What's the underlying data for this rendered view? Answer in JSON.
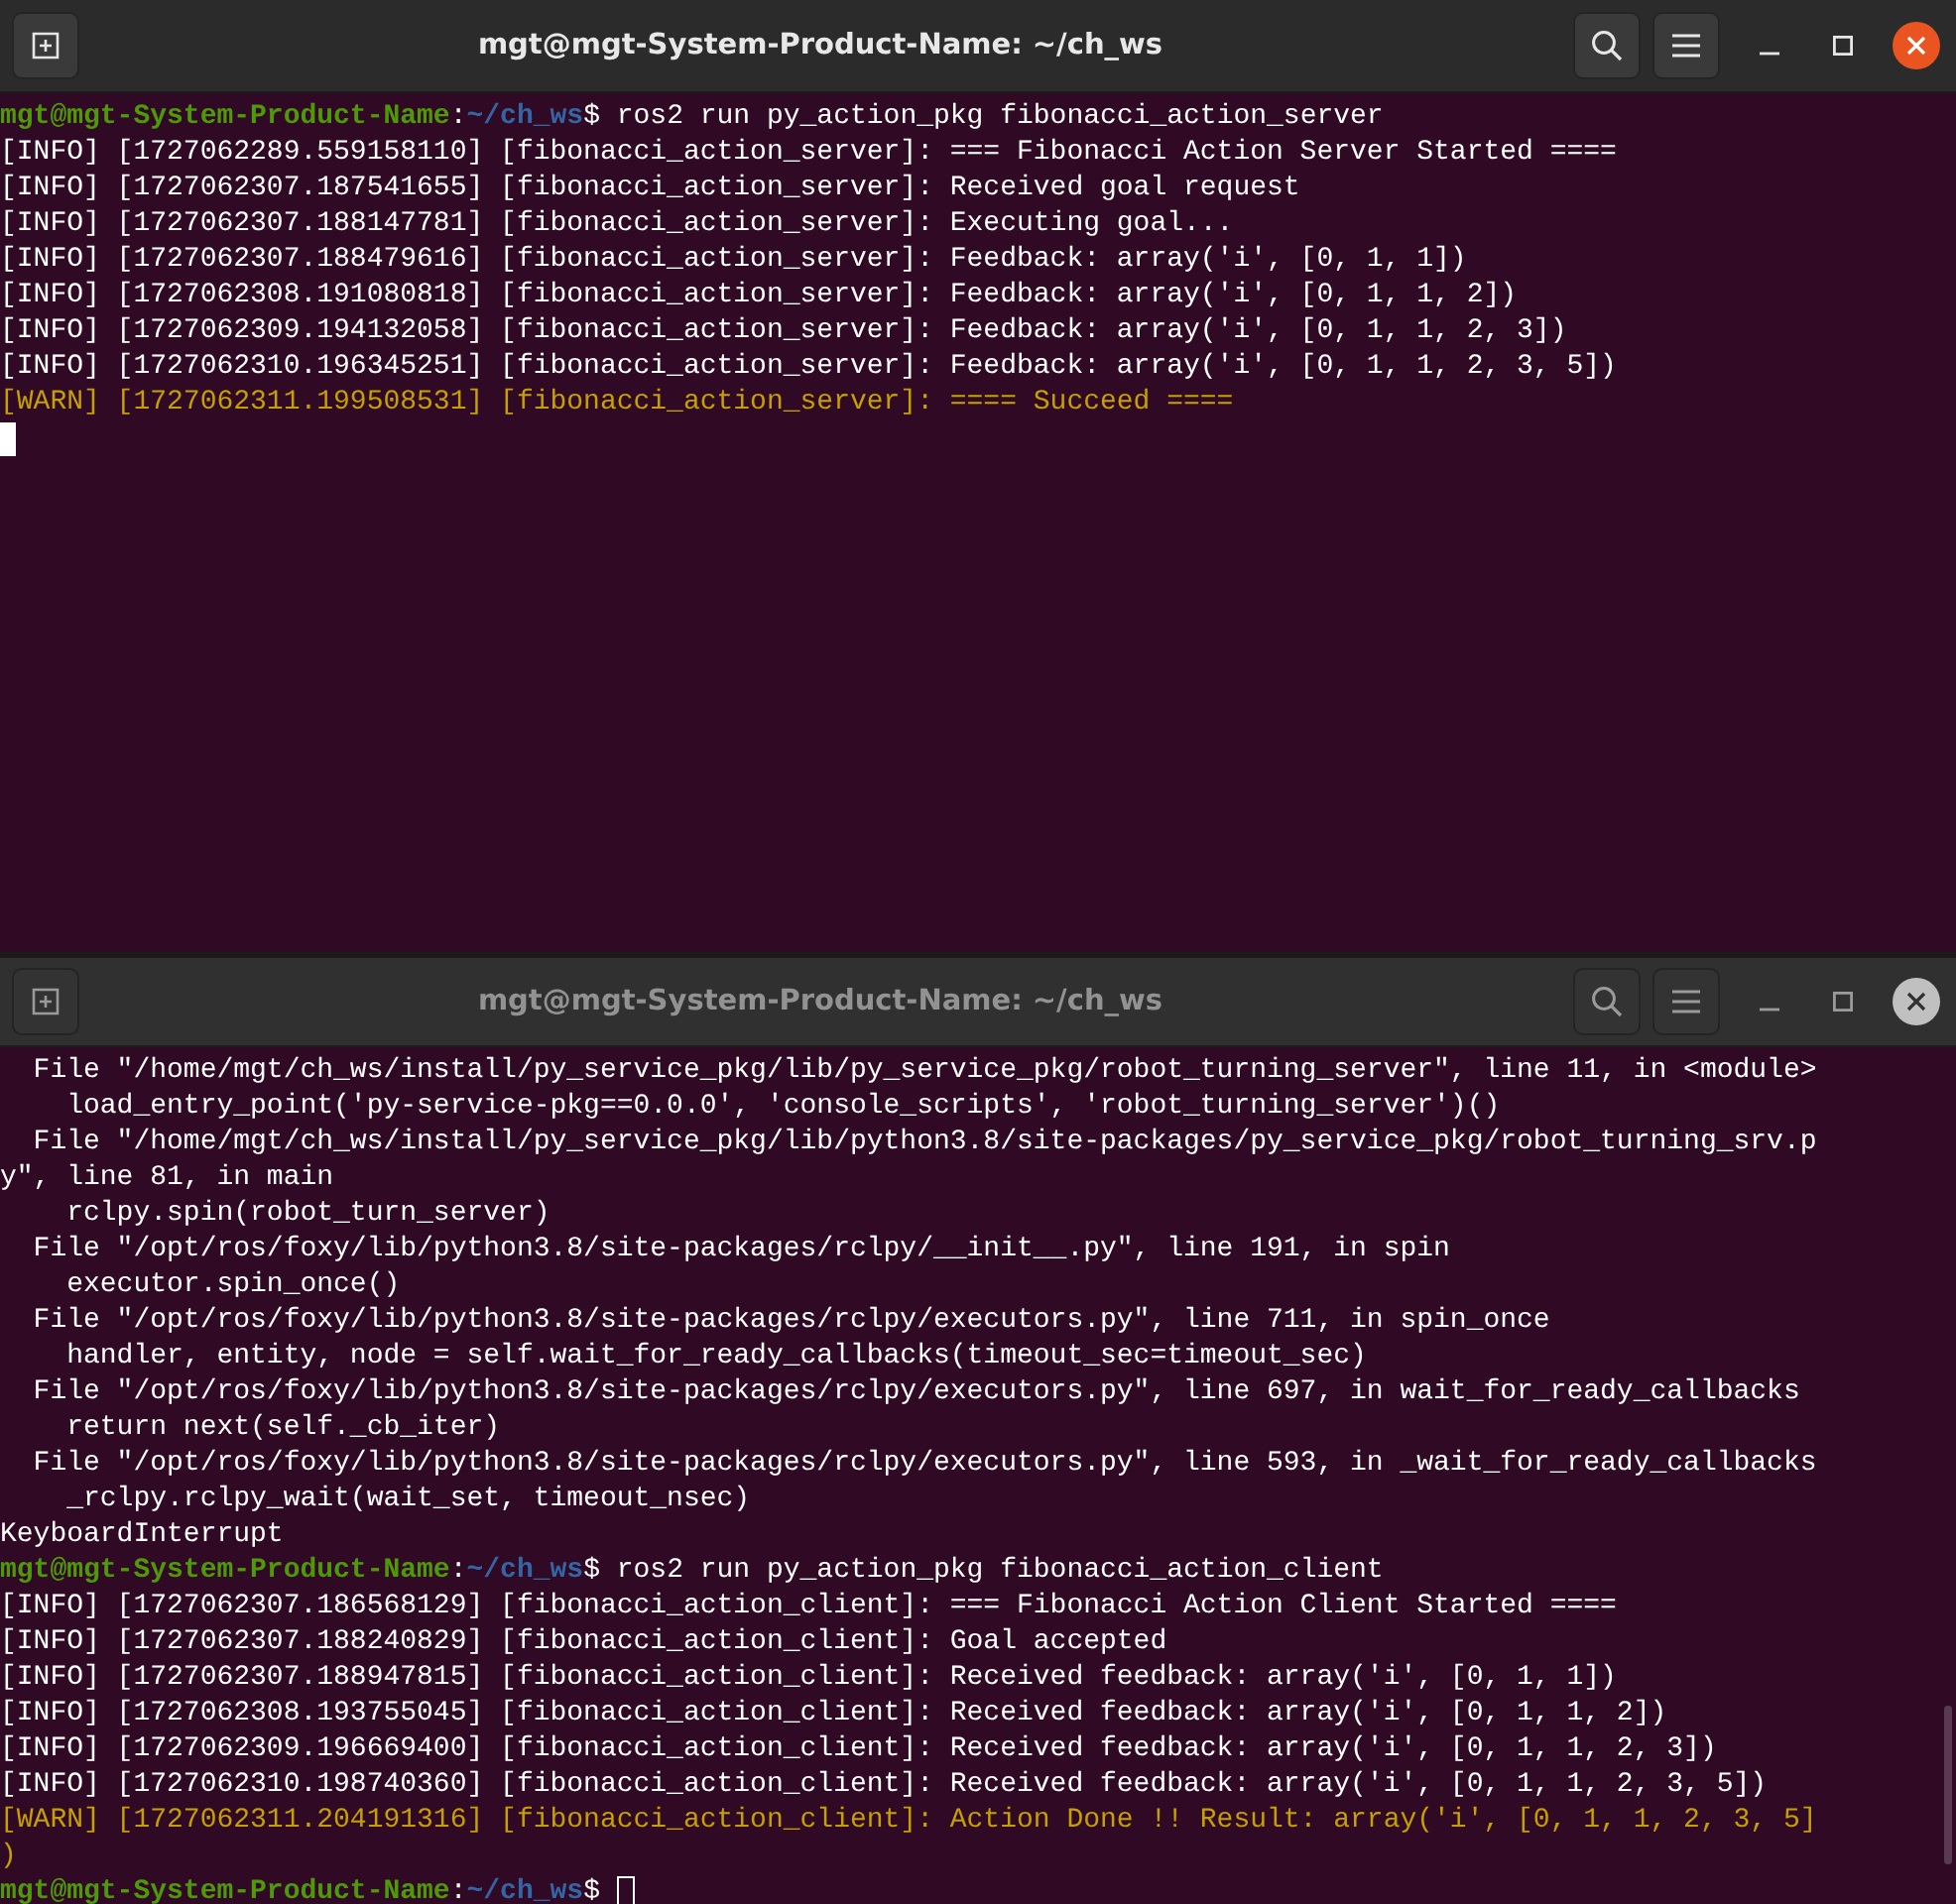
{
  "windows": [
    {
      "title": "mgt@mgt-System-Product-Name: ~/ch_ws",
      "active": true,
      "lines": [
        {
          "kind": "prompt",
          "segments": [
            "mgt@mgt-System-Product-Name",
            ":",
            "~/ch_ws",
            "$ ros2 run py_action_pkg fibonacci_action_server"
          ]
        },
        {
          "kind": "info",
          "text": "[INFO] [1727062289.559158110] [fibonacci_action_server]: === Fibonacci Action Server Started ===="
        },
        {
          "kind": "info",
          "text": "[INFO] [1727062307.187541655] [fibonacci_action_server]: Received goal request"
        },
        {
          "kind": "info",
          "text": "[INFO] [1727062307.188147781] [fibonacci_action_server]: Executing goal..."
        },
        {
          "kind": "info",
          "text": "[INFO] [1727062307.188479616] [fibonacci_action_server]: Feedback: array('i', [0, 1, 1])"
        },
        {
          "kind": "info",
          "text": "[INFO] [1727062308.191080818] [fibonacci_action_server]: Feedback: array('i', [0, 1, 1, 2])"
        },
        {
          "kind": "info",
          "text": "[INFO] [1727062309.194132058] [fibonacci_action_server]: Feedback: array('i', [0, 1, 1, 2, 3])"
        },
        {
          "kind": "info",
          "text": "[INFO] [1727062310.196345251] [fibonacci_action_server]: Feedback: array('i', [0, 1, 1, 2, 3, 5])"
        },
        {
          "kind": "warn",
          "text": "[WARN] [1727062311.199508531] [fibonacci_action_server]: ==== Succeed ===="
        },
        {
          "kind": "cursor"
        }
      ]
    },
    {
      "title": "mgt@mgt-System-Product-Name: ~/ch_ws",
      "active": false,
      "lines": [
        {
          "kind": "info",
          "text": "  File \"/home/mgt/ch_ws/install/py_service_pkg/lib/py_service_pkg/robot_turning_server\", line 11, in <module>"
        },
        {
          "kind": "info",
          "text": "    load_entry_point('py-service-pkg==0.0.0', 'console_scripts', 'robot_turning_server')()"
        },
        {
          "kind": "info",
          "text": "  File \"/home/mgt/ch_ws/install/py_service_pkg/lib/python3.8/site-packages/py_service_pkg/robot_turning_srv.p"
        },
        {
          "kind": "info",
          "text": "y\", line 81, in main"
        },
        {
          "kind": "info",
          "text": "    rclpy.spin(robot_turn_server)"
        },
        {
          "kind": "info",
          "text": "  File \"/opt/ros/foxy/lib/python3.8/site-packages/rclpy/__init__.py\", line 191, in spin"
        },
        {
          "kind": "info",
          "text": "    executor.spin_once()"
        },
        {
          "kind": "info",
          "text": "  File \"/opt/ros/foxy/lib/python3.8/site-packages/rclpy/executors.py\", line 711, in spin_once"
        },
        {
          "kind": "info",
          "text": "    handler, entity, node = self.wait_for_ready_callbacks(timeout_sec=timeout_sec)"
        },
        {
          "kind": "info",
          "text": "  File \"/opt/ros/foxy/lib/python3.8/site-packages/rclpy/executors.py\", line 697, in wait_for_ready_callbacks"
        },
        {
          "kind": "info",
          "text": "    return next(self._cb_iter)"
        },
        {
          "kind": "info",
          "text": "  File \"/opt/ros/foxy/lib/python3.8/site-packages/rclpy/executors.py\", line 593, in _wait_for_ready_callbacks"
        },
        {
          "kind": "info",
          "text": "    _rclpy.rclpy_wait(wait_set, timeout_nsec)"
        },
        {
          "kind": "info",
          "text": "KeyboardInterrupt"
        },
        {
          "kind": "prompt",
          "segments": [
            "mgt@mgt-System-Product-Name",
            ":",
            "~/ch_ws",
            "$ ros2 run py_action_pkg fibonacci_action_client"
          ]
        },
        {
          "kind": "info",
          "text": "[INFO] [1727062307.186568129] [fibonacci_action_client]: === Fibonacci Action Client Started ===="
        },
        {
          "kind": "info",
          "text": "[INFO] [1727062307.188240829] [fibonacci_action_client]: Goal accepted"
        },
        {
          "kind": "info",
          "text": "[INFO] [1727062307.188947815] [fibonacci_action_client]: Received feedback: array('i', [0, 1, 1])"
        },
        {
          "kind": "info",
          "text": "[INFO] [1727062308.193755045] [fibonacci_action_client]: Received feedback: array('i', [0, 1, 1, 2])"
        },
        {
          "kind": "info",
          "text": "[INFO] [1727062309.196669400] [fibonacci_action_client]: Received feedback: array('i', [0, 1, 1, 2, 3])"
        },
        {
          "kind": "info",
          "text": "[INFO] [1727062310.198740360] [fibonacci_action_client]: Received feedback: array('i', [0, 1, 1, 2, 3, 5])"
        },
        {
          "kind": "warn",
          "text": "[WARN] [1727062311.204191316] [fibonacci_action_client]: Action Done !! Result: array('i', [0, 1, 1, 2, 3, 5]"
        },
        {
          "kind": "warn",
          "text": ")"
        },
        {
          "kind": "prompt",
          "cursor": true,
          "segments": [
            "mgt@mgt-System-Product-Name",
            ":",
            "~/ch_ws",
            "$ "
          ]
        }
      ]
    }
  ]
}
